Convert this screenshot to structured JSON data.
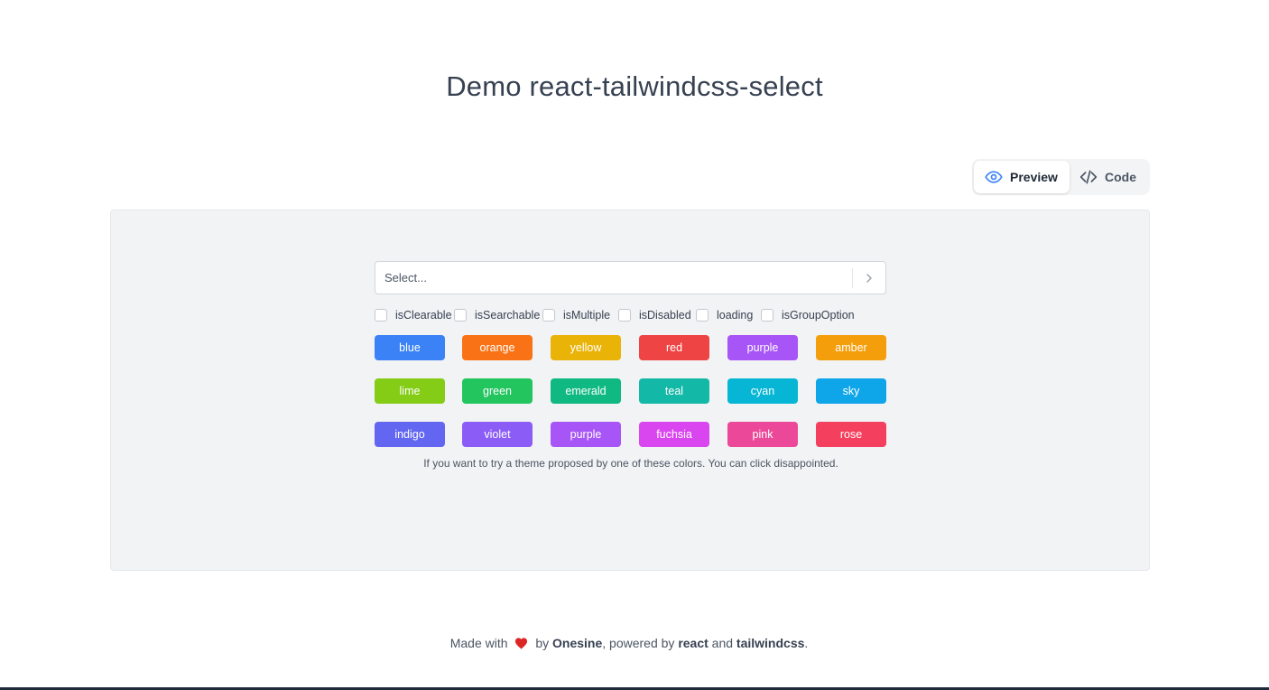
{
  "page": {
    "title": "Demo react-tailwindcss-select"
  },
  "tabs": {
    "preview_label": "Preview",
    "code_label": "Code",
    "active": "Preview"
  },
  "select": {
    "placeholder": "Select...",
    "chevron_icon": "chevron-right-icon"
  },
  "options": [
    {
      "label": "isClearable",
      "checked": false
    },
    {
      "label": "isSearchable",
      "checked": false
    },
    {
      "label": "isMultiple",
      "checked": false
    },
    {
      "label": "isDisabled",
      "checked": false
    },
    {
      "label": "loading",
      "checked": false
    },
    {
      "label": "isGroupOption",
      "checked": false
    }
  ],
  "themes": [
    {
      "label": "blue",
      "color": "#3b82f6"
    },
    {
      "label": "orange",
      "color": "#f97316"
    },
    {
      "label": "yellow",
      "color": "#eab308"
    },
    {
      "label": "red",
      "color": "#ef4444"
    },
    {
      "label": "purple",
      "color": "#a855f7"
    },
    {
      "label": "amber",
      "color": "#f59e0b"
    },
    {
      "label": "lime",
      "color": "#84cc16"
    },
    {
      "label": "green",
      "color": "#22c55e"
    },
    {
      "label": "emerald",
      "color": "#10b981"
    },
    {
      "label": "teal",
      "color": "#14b8a6"
    },
    {
      "label": "cyan",
      "color": "#06b6d4"
    },
    {
      "label": "sky",
      "color": "#0ea5e9"
    },
    {
      "label": "indigo",
      "color": "#6366f1"
    },
    {
      "label": "violet",
      "color": "#8b5cf6"
    },
    {
      "label": "purple",
      "color": "#a855f7"
    },
    {
      "label": "fuchsia",
      "color": "#d946ef"
    },
    {
      "label": "pink",
      "color": "#ec4899"
    },
    {
      "label": "rose",
      "color": "#f43f5e"
    }
  ],
  "hint": "If you want to try a theme proposed by one of these colors. You can click disappointed.",
  "footer": {
    "made_with": "Made with",
    "heart_icon": "heart-icon",
    "by": "by",
    "author": "Onesine",
    "powered_by": ", powered by",
    "lib1": "react",
    "and": "and",
    "lib2": "tailwindcss",
    "period": "."
  },
  "colors": {
    "accent_eye": "#3b82f6",
    "heart": "#dc2626"
  }
}
